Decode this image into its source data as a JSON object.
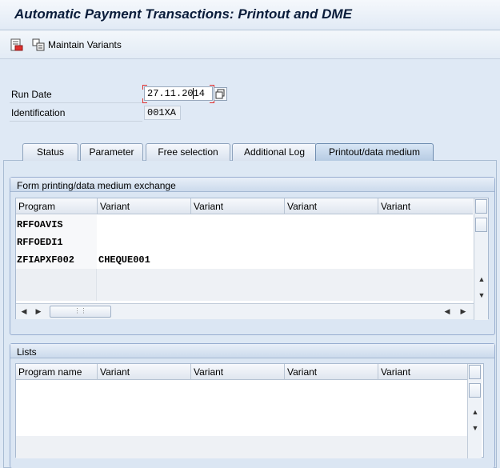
{
  "window": {
    "title": "Automatic Payment Transactions: Printout and DME"
  },
  "toolbar": {
    "maintain_variants_label": "Maintain Variants"
  },
  "form": {
    "run_date_label": "Run Date",
    "run_date_value": "27.11.2014",
    "identification_label": "Identification",
    "identification_value": "001XA"
  },
  "tabs": [
    {
      "label": "Status"
    },
    {
      "label": "Parameter"
    },
    {
      "label": "Free selection"
    },
    {
      "label": "Additional Log"
    },
    {
      "label": "Printout/data medium",
      "active": true
    }
  ],
  "form_printing": {
    "title": "Form printing/data medium exchange",
    "columns": [
      "Program",
      "Variant",
      "Variant",
      "Variant",
      "Variant"
    ],
    "rows": [
      {
        "program": "RFFOAVIS",
        "variant": ""
      },
      {
        "program": "RFFOEDI1",
        "variant": ""
      },
      {
        "program": "ZFIAPXF002",
        "variant": "CHEQUE001"
      }
    ]
  },
  "lists": {
    "title": "Lists",
    "columns": [
      "Program name",
      "Variant",
      "Variant",
      "Variant",
      "Variant"
    ]
  },
  "colors": {
    "accent_red": "#e0302e",
    "panel_blue": "#dde8f4",
    "active_tab": "#b6cbe3"
  }
}
